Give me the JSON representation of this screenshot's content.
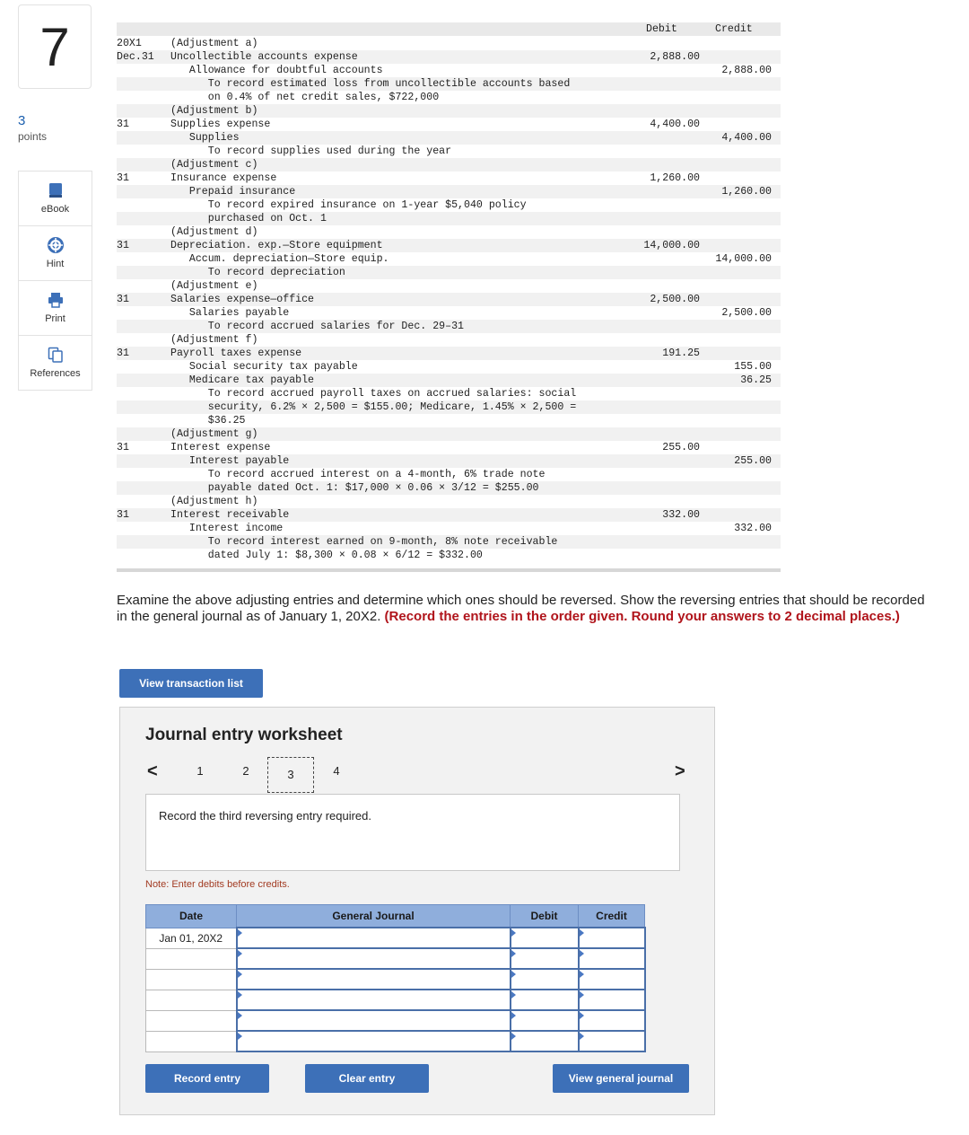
{
  "question": {
    "number": "7",
    "points_value": "3",
    "points_label": "points"
  },
  "sidebar": {
    "items": [
      {
        "label": "eBook",
        "icon": "book-icon"
      },
      {
        "label": "Hint",
        "icon": "lifebuoy-icon"
      },
      {
        "label": "Print",
        "icon": "printer-icon"
      },
      {
        "label": "References",
        "icon": "copy-icon"
      }
    ]
  },
  "entries": {
    "header": {
      "debit": "Debit",
      "credit": "Credit"
    },
    "lines": [
      {
        "date": "20X1",
        "desc": "(Adjustment a)",
        "debit": "",
        "credit": ""
      },
      {
        "date": "Dec.31",
        "desc": "Uncollectible accounts expense",
        "debit": "2,888.00",
        "credit": ""
      },
      {
        "date": "",
        "desc": "   Allowance for doubtful accounts",
        "debit": "",
        "credit": "2,888.00"
      },
      {
        "date": "",
        "desc": "      To record estimated loss from uncollectible accounts based",
        "debit": "",
        "credit": ""
      },
      {
        "date": "",
        "desc": "      on 0.4% of net credit sales, $722,000",
        "debit": "",
        "credit": ""
      },
      {
        "date": "",
        "desc": "(Adjustment b)",
        "debit": "",
        "credit": ""
      },
      {
        "date": "31",
        "desc": "Supplies expense",
        "debit": "4,400.00",
        "credit": ""
      },
      {
        "date": "",
        "desc": "   Supplies",
        "debit": "",
        "credit": "4,400.00"
      },
      {
        "date": "",
        "desc": "      To record supplies used during the year",
        "debit": "",
        "credit": ""
      },
      {
        "date": "",
        "desc": "(Adjustment c)",
        "debit": "",
        "credit": ""
      },
      {
        "date": "31",
        "desc": "Insurance expense",
        "debit": "1,260.00",
        "credit": ""
      },
      {
        "date": "",
        "desc": "   Prepaid insurance",
        "debit": "",
        "credit": "1,260.00"
      },
      {
        "date": "",
        "desc": "      To record expired insurance on 1-year $5,040 policy",
        "debit": "",
        "credit": ""
      },
      {
        "date": "",
        "desc": "      purchased on Oct. 1",
        "debit": "",
        "credit": ""
      },
      {
        "date": "",
        "desc": "(Adjustment d)",
        "debit": "",
        "credit": ""
      },
      {
        "date": "31",
        "desc": "Depreciation. exp.—Store equipment",
        "debit": "14,000.00",
        "credit": ""
      },
      {
        "date": "",
        "desc": "   Accum. depreciation—Store equip.",
        "debit": "",
        "credit": "14,000.00"
      },
      {
        "date": "",
        "desc": "      To record depreciation",
        "debit": "",
        "credit": ""
      },
      {
        "date": "",
        "desc": "(Adjustment e)",
        "debit": "",
        "credit": ""
      },
      {
        "date": "31",
        "desc": "Salaries expense—office",
        "debit": "2,500.00",
        "credit": ""
      },
      {
        "date": "",
        "desc": "   Salaries payable",
        "debit": "",
        "credit": "2,500.00"
      },
      {
        "date": "",
        "desc": "      To record accrued salaries for Dec. 29–31",
        "debit": "",
        "credit": ""
      },
      {
        "date": "",
        "desc": "(Adjustment f)",
        "debit": "",
        "credit": ""
      },
      {
        "date": "31",
        "desc": "Payroll taxes expense",
        "debit": "191.25",
        "credit": ""
      },
      {
        "date": "",
        "desc": "   Social security tax payable",
        "debit": "",
        "credit": "155.00"
      },
      {
        "date": "",
        "desc": "   Medicare tax payable",
        "debit": "",
        "credit": "36.25"
      },
      {
        "date": "",
        "desc": "      To record accrued payroll taxes on accrued salaries: social",
        "debit": "",
        "credit": ""
      },
      {
        "date": "",
        "desc": "      security, 6.2% × 2,500 = $155.00; Medicare, 1.45% × 2,500 =",
        "debit": "",
        "credit": ""
      },
      {
        "date": "",
        "desc": "      $36.25",
        "debit": "",
        "credit": ""
      },
      {
        "date": "",
        "desc": "(Adjustment g)",
        "debit": "",
        "credit": ""
      },
      {
        "date": "31",
        "desc": "Interest expense",
        "debit": "255.00",
        "credit": ""
      },
      {
        "date": "",
        "desc": "   Interest payable",
        "debit": "",
        "credit": "255.00"
      },
      {
        "date": "",
        "desc": "      To record accrued interest on a 4-month, 6% trade note",
        "debit": "",
        "credit": ""
      },
      {
        "date": "",
        "desc": "      payable dated Oct. 1: $17,000 × 0.06 × 3/12 = $255.00",
        "debit": "",
        "credit": ""
      },
      {
        "date": "",
        "desc": "(Adjustment h)",
        "debit": "",
        "credit": ""
      },
      {
        "date": "31",
        "desc": "Interest receivable",
        "debit": "332.00",
        "credit": ""
      },
      {
        "date": "",
        "desc": "   Interest income",
        "debit": "",
        "credit": "332.00"
      },
      {
        "date": "",
        "desc": "      To record interest earned on 9-month, 8% note receivable",
        "debit": "",
        "credit": ""
      },
      {
        "date": "",
        "desc": "      dated July 1: $8,300 × 0.08 × 6/12 = $332.00",
        "debit": "",
        "credit": ""
      }
    ]
  },
  "instructions": {
    "text": "Examine the above adjusting entries and determine which ones should be reversed. Show the reversing entries that should be recorded in the general journal as of January 1, 20X2.",
    "emphasis": "(Record the entries in the order given. Round your answers to 2 decimal places.)"
  },
  "buttons": {
    "view_transactions": "View transaction list",
    "record": "Record entry",
    "clear": "Clear entry",
    "view_journal": "View general journal"
  },
  "worksheet": {
    "title": "Journal entry worksheet",
    "tabs": [
      "1",
      "2",
      "3",
      "4"
    ],
    "active_tab": "3",
    "prompt": "Record the third reversing entry required.",
    "note": "Note: Enter debits before credits.",
    "columns": [
      "Date",
      "General Journal",
      "Debit",
      "Credit"
    ],
    "rows": [
      {
        "date": "Jan 01, 20X2"
      },
      {
        "date": ""
      },
      {
        "date": ""
      },
      {
        "date": ""
      },
      {
        "date": ""
      },
      {
        "date": ""
      }
    ]
  },
  "colors": {
    "accent": "#3d70b8",
    "table_header": "#8faedc",
    "emphasis": "#b0141b"
  }
}
